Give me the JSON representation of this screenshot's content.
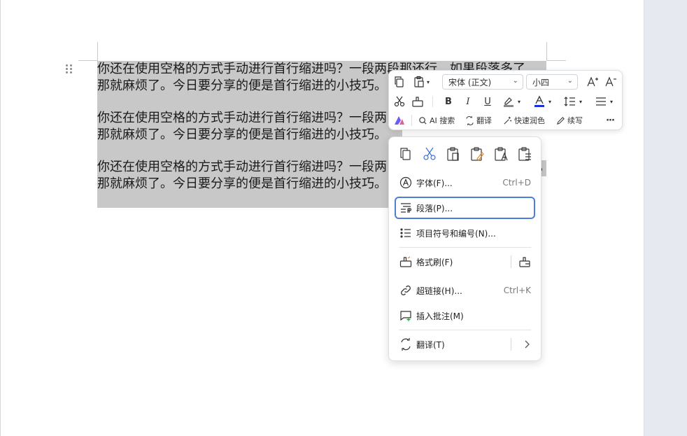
{
  "document": {
    "paragraphs": [
      {
        "line1": "你还在使用空格的方式手动进行首行缩进吗？一段两段那还行，如果段落多了",
        "line2": "那就麻烦了。今日要分享的便是首行缩进的小技巧。"
      },
      {
        "line1": "你还在使用空格的方式手动进行首行缩进吗？一段两",
        "line2": "那就麻烦了。今日要分享的便是首行缩进的小技巧。"
      },
      {
        "line1": "你还在使用空格的方式手动进行首行缩进吗？一段两",
        "line1_tail": "，",
        "line2": "那就麻烦了。今日要分享的便是首行缩进的小技巧。"
      }
    ]
  },
  "toolbar": {
    "font_name": "宋体 (正文)",
    "font_size": "小四",
    "ai_search_label": "AI 搜索",
    "translate_label": "翻译",
    "polish_label": "快速润色",
    "continue_label": "续写",
    "bold_label": "B",
    "italic_label": "I",
    "underline_label": "U",
    "more_label": "···",
    "colors": {
      "font_color": "#1a2fd6",
      "highlight": "#8a8a8a",
      "ai_brand": "#6b5cf5"
    }
  },
  "context_menu": {
    "items": [
      {
        "label": "字体(F)...",
        "shortcut": "Ctrl+D"
      },
      {
        "label": "段落(P)...",
        "shortcut": ""
      },
      {
        "label": "项目符号和编号(N)...",
        "shortcut": ""
      },
      {
        "label": "格式刷(F)",
        "shortcut": ""
      },
      {
        "label": "超链接(H)...",
        "shortcut": "Ctrl+K"
      },
      {
        "label": "插入批注(M)",
        "shortcut": ""
      },
      {
        "label": "翻译(T)",
        "shortcut": ""
      }
    ],
    "active_index": 1,
    "accent_color": "#4a7ed8"
  }
}
